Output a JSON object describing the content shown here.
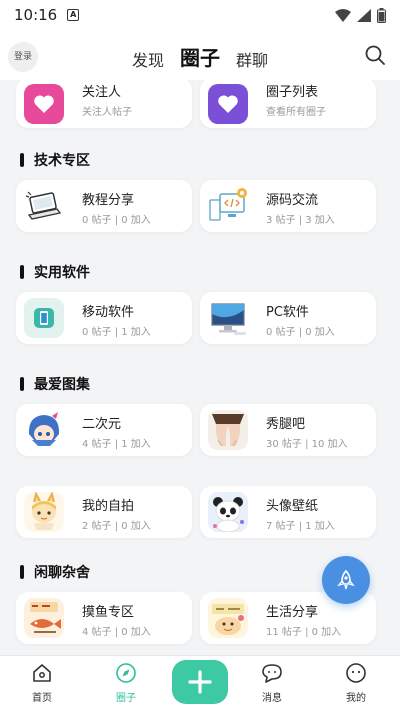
{
  "status": {
    "time": "10:16",
    "badge": "A"
  },
  "header": {
    "login_label": "登录",
    "tabs": [
      {
        "label": "发现",
        "active": false
      },
      {
        "label": "圈子",
        "active": true
      },
      {
        "label": "群聊",
        "active": false
      }
    ]
  },
  "top_cards": [
    {
      "title": "关注人",
      "subtitle": "关注人帖子",
      "color": "#e84a9b",
      "icon": "heart-icon"
    },
    {
      "title": "圈子列表",
      "subtitle": "查看所有圈子",
      "color": "#7b4fd6",
      "icon": "heart-icon"
    }
  ],
  "sections": [
    {
      "title": "技术专区",
      "items": [
        {
          "title": "教程分享",
          "subtitle": "0 帖子 | 0 加入",
          "icon": "laptop-icon"
        },
        {
          "title": "源码交流",
          "subtitle": "3 帖子 | 3 加入",
          "icon": "computer-code-icon"
        }
      ]
    },
    {
      "title": "实用软件",
      "items": [
        {
          "title": "移动软件",
          "subtitle": "0 帖子 | 1 加入",
          "icon": "phone-icon"
        },
        {
          "title": "PC软件",
          "subtitle": "0 帖子 | 0 加入",
          "icon": "monitor-icon"
        }
      ]
    },
    {
      "title": "最爱图集",
      "items": [
        {
          "title": "二次元",
          "subtitle": "4 帖子 | 1 加入",
          "icon": "anime-girl-icon"
        },
        {
          "title": "秀腿吧",
          "subtitle": "30 帖子 | 10 加入",
          "icon": "legs-photo-icon"
        },
        {
          "title": "我的自拍",
          "subtitle": "2 帖子 | 0 加入",
          "icon": "selfie-icon"
        },
        {
          "title": "头像壁纸",
          "subtitle": "7 帖子 | 1 加入",
          "icon": "panda-icon"
        }
      ]
    },
    {
      "title": "闲聊杂舍",
      "items": [
        {
          "title": "摸鱼专区",
          "subtitle": "4 帖子 | 0 加入",
          "icon": "fish-icon"
        },
        {
          "title": "生活分享",
          "subtitle": "11 帖子 | 0 加入",
          "icon": "life-icon"
        }
      ]
    }
  ],
  "bottom_nav": [
    {
      "label": "首页",
      "icon": "home-icon",
      "active": false
    },
    {
      "label": "圈子",
      "icon": "compass-icon",
      "active": true
    },
    {
      "label": "消息",
      "icon": "chat-icon",
      "active": false
    },
    {
      "label": "我的",
      "icon": "profile-icon",
      "active": false
    }
  ],
  "colors": {
    "accent": "#3cc9a4",
    "fab": "#4a90e2"
  }
}
